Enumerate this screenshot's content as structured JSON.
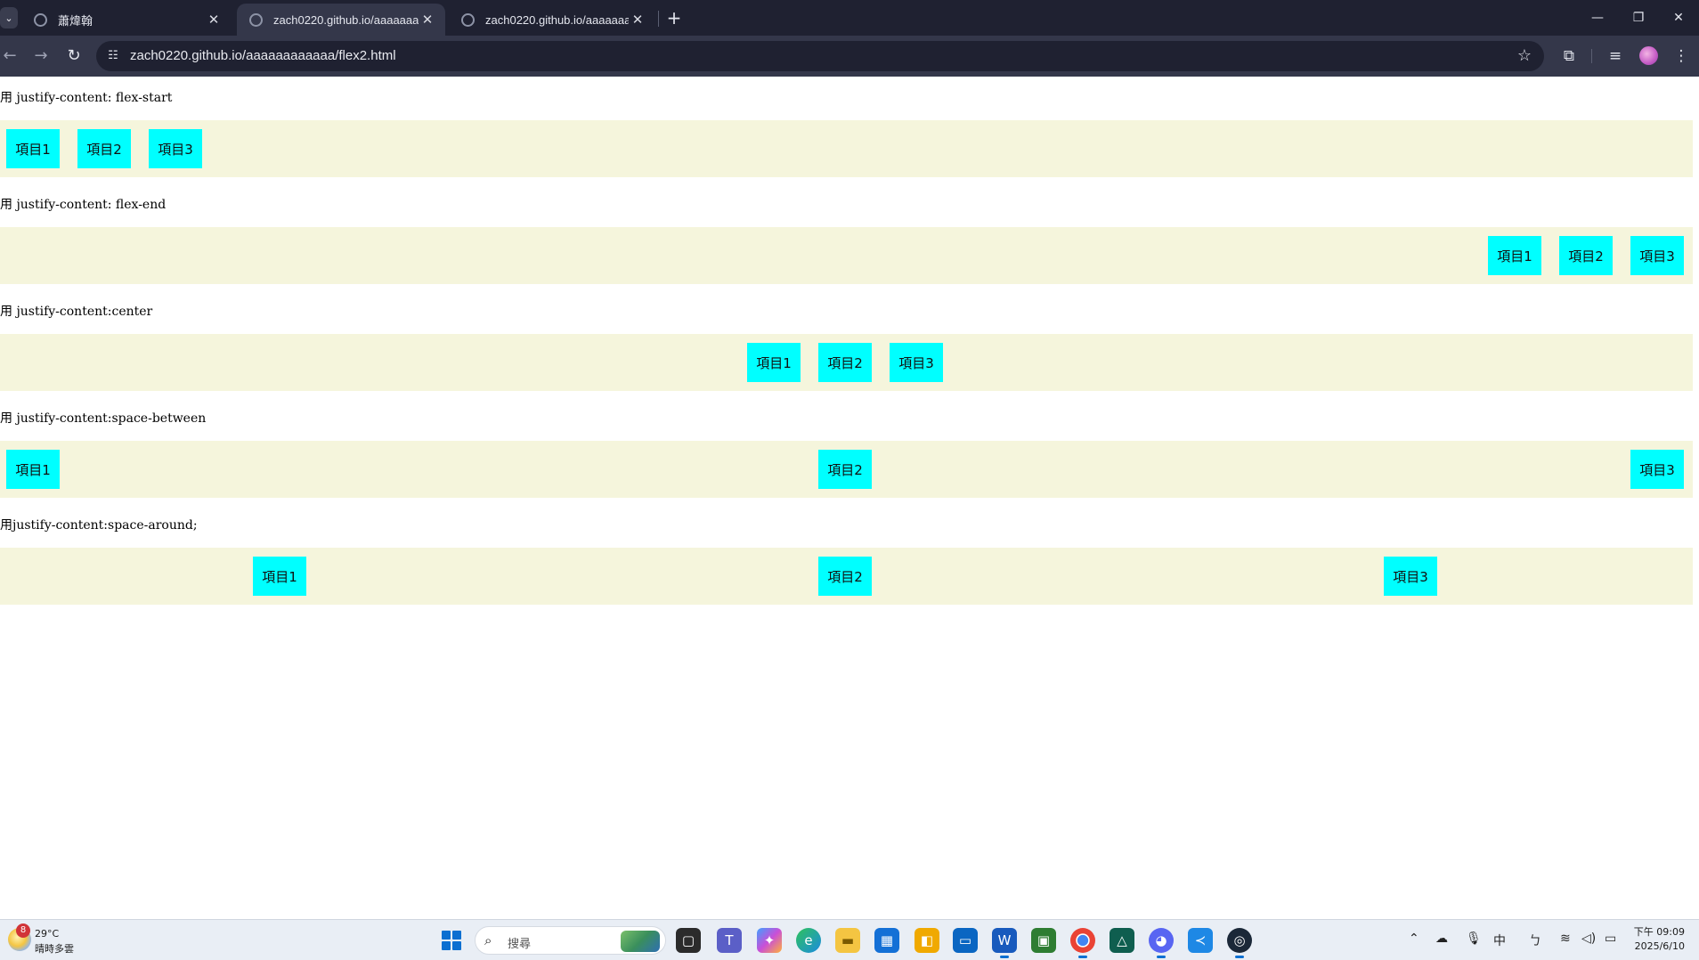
{
  "browser": {
    "tabs": [
      {
        "title": "蕭煒翰",
        "active": false
      },
      {
        "title": "zach0220.github.io/aaaaaaaa",
        "active": true
      },
      {
        "title": "zach0220.github.io/aaaaaaaa",
        "active": false
      }
    ],
    "url": "zach0220.github.io/aaaaaaaaaaaa/flex2.html",
    "icons": {
      "back": "arrow-left-icon",
      "forward": "arrow-right-icon",
      "reload": "reload-icon",
      "site_info": "tune-icon",
      "bookmark": "star-icon",
      "extensions": "puzzle-icon",
      "media": "media-queue-icon",
      "menu": "kebab-menu-icon"
    },
    "colors": {
      "frame": "#1f2131",
      "toolbar": "#34374a",
      "omnibox": "#1f2131"
    }
  },
  "page": {
    "colors": {
      "container_bg": "#f5f5dc",
      "item_bg": "#00ffff"
    },
    "sections": [
      {
        "label": "用 justify-content: flex-start",
        "items": [
          "項目1",
          "項目2",
          "項目3"
        ]
      },
      {
        "label": "用 justify-content: flex-end",
        "items": [
          "項目1",
          "項目2",
          "項目3"
        ]
      },
      {
        "label": "用 justify-content:center",
        "items": [
          "項目1",
          "項目2",
          "項目3"
        ]
      },
      {
        "label": "用 justify-content:space-between",
        "items": [
          "項目1",
          "項目2",
          "項目3"
        ]
      },
      {
        "label": "用justify-content:space-around;",
        "items": [
          "項目1",
          "項目2",
          "項目3"
        ]
      }
    ]
  },
  "taskbar": {
    "weather": {
      "badge": "8",
      "temp": "29°C",
      "desc": "晴時多雲"
    },
    "search_placeholder": "搜尋",
    "apps": [
      "task-view",
      "teams",
      "copilot",
      "edge",
      "file-explorer",
      "ms-store",
      "wallet",
      "remote",
      "word",
      "minecraft",
      "chrome",
      "vpn",
      "discord",
      "vscode",
      "steam"
    ],
    "tray": {
      "ime": "中"
    },
    "clock": {
      "time": "下午 09:09",
      "date": "2025/6/10"
    }
  }
}
